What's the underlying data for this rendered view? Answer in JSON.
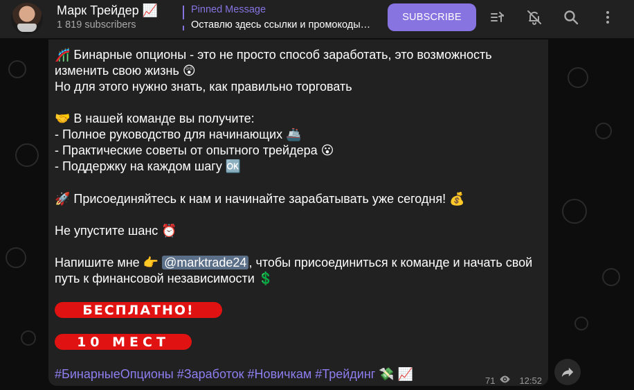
{
  "header": {
    "channel_title": "Марк Трейдер 📈",
    "subscribers": "1 819 subscribers",
    "pinned_label": "Pinned Message",
    "pinned_text": "Оставлю здесь ссылки и промокоды…",
    "subscribe_label": "SUBSCRIBE",
    "icons": [
      "pinned-list-icon",
      "mute-bell-icon",
      "search-icon",
      "more-vertical-icon"
    ]
  },
  "message": {
    "line1": "🎢 Бинарные опционы - это не просто способ заработать, это возможность",
    "line2": "изменить свою жизнь 😲",
    "line3": " Но для этого нужно знать, как правильно торговать",
    "line4": "🤝 В нашей команде вы получите:",
    "line5": "- Полное руководство для начинающих 🚢",
    "line6": "- Практические советы от опытного трейдера 😮",
    "line7": "- Поддержку на каждом шагу 🆗",
    "line8": "🚀 Присоединяйтесь к нам и начинайте зарабатывать уже сегодня! 💰",
    "line9": "Не упустите шанс ⏰",
    "line10_pre": "Напишите мне 👉 ",
    "mention": "@marktrade24",
    "line10_post": ", чтобы присоединиться к команде и начать свой",
    "line11": "путь к финансовой независимости 💲",
    "badge1": "БЕСПЛАТНО!",
    "badge2": "10 МЕСТ",
    "hashtags": [
      "#БинарныеОпционы",
      "#Заработок",
      "#Новичкам",
      "#Трейдинг"
    ],
    "hashtag_emojis": "💸 📈",
    "views": "71",
    "time": "12:52"
  },
  "colors": {
    "accent": "#8774e1",
    "bubble": "#212121",
    "badge_red": "#e01212",
    "mention_bg": "#5b6f88"
  }
}
